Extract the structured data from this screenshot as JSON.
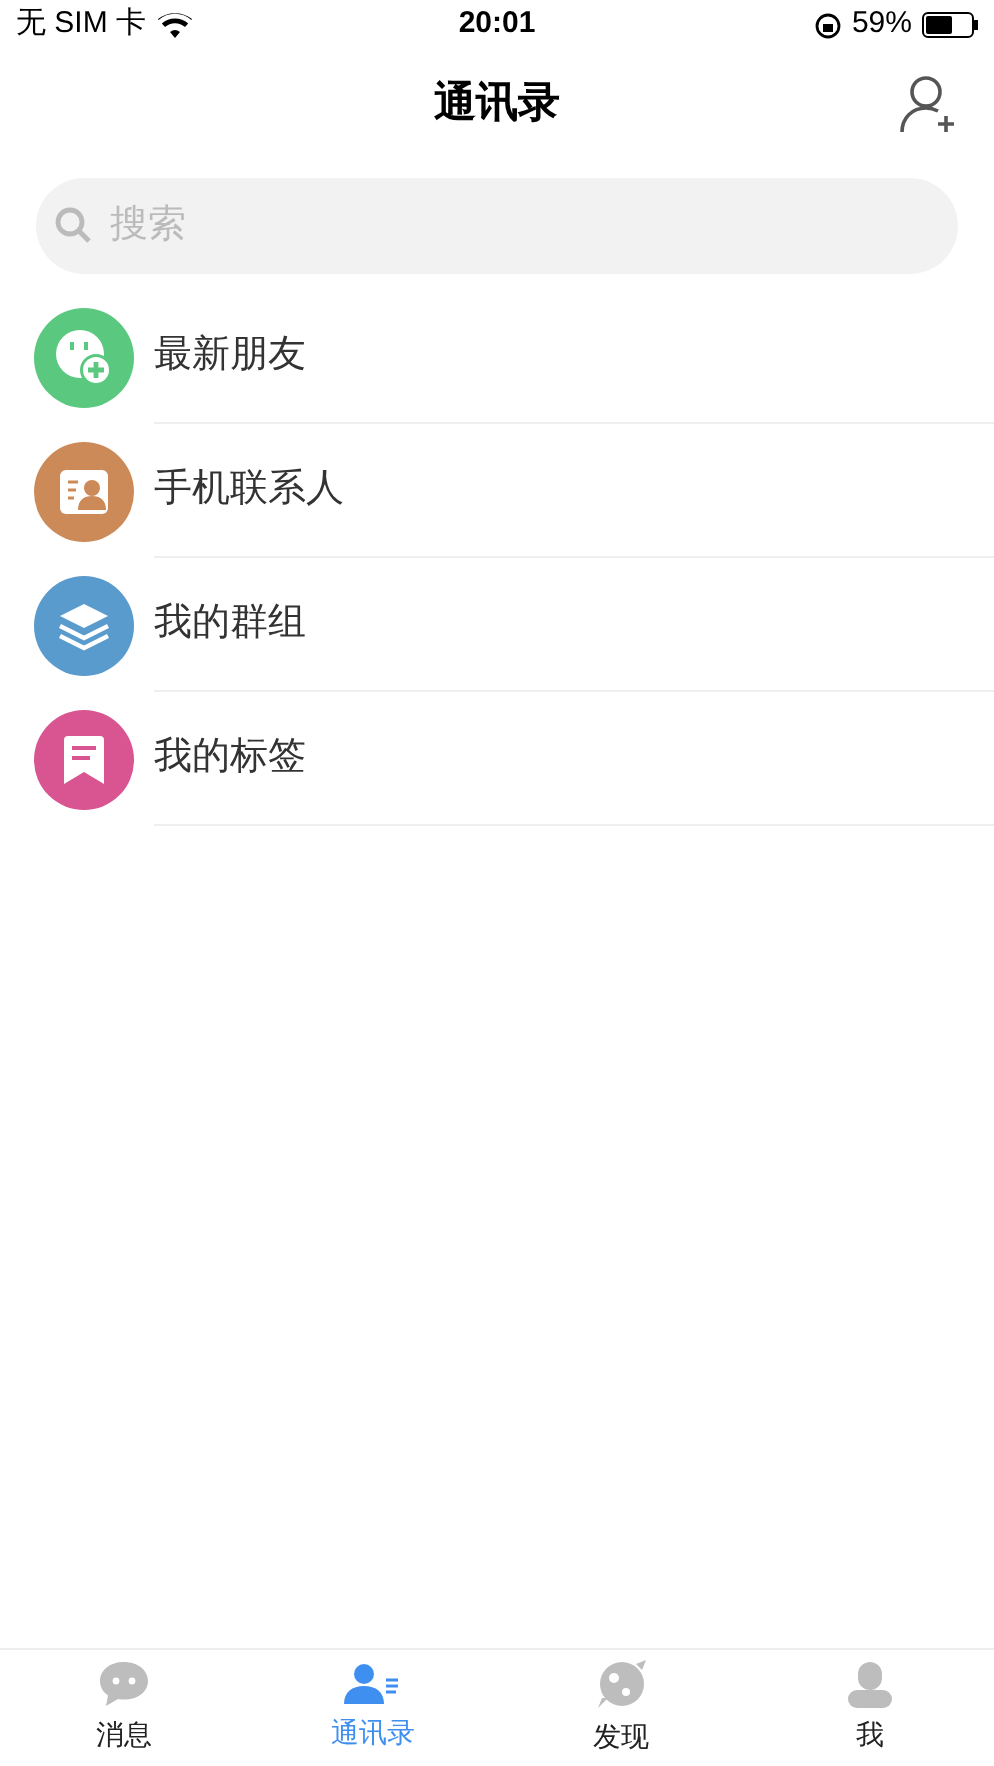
{
  "status_bar": {
    "carrier": "无 SIM 卡",
    "time": "20:01",
    "battery": "59%"
  },
  "nav": {
    "title": "通讯录"
  },
  "search": {
    "placeholder": "搜索"
  },
  "items": [
    {
      "label": "最新朋友",
      "kind": "new-friend",
      "color": "#5ac87f"
    },
    {
      "label": "手机联系人",
      "kind": "phone-contacts",
      "color": "#cc8a58"
    },
    {
      "label": "我的群组",
      "kind": "groups",
      "color": "#5a9bcd"
    },
    {
      "label": "我的标签",
      "kind": "tags",
      "color": "#d95592"
    }
  ],
  "tabs": [
    {
      "label": "消息",
      "kind": "chat",
      "selected": false
    },
    {
      "label": "通讯录",
      "kind": "contacts",
      "selected": true
    },
    {
      "label": "发现",
      "kind": "discover",
      "selected": false
    },
    {
      "label": "我",
      "kind": "me",
      "selected": false
    }
  ]
}
